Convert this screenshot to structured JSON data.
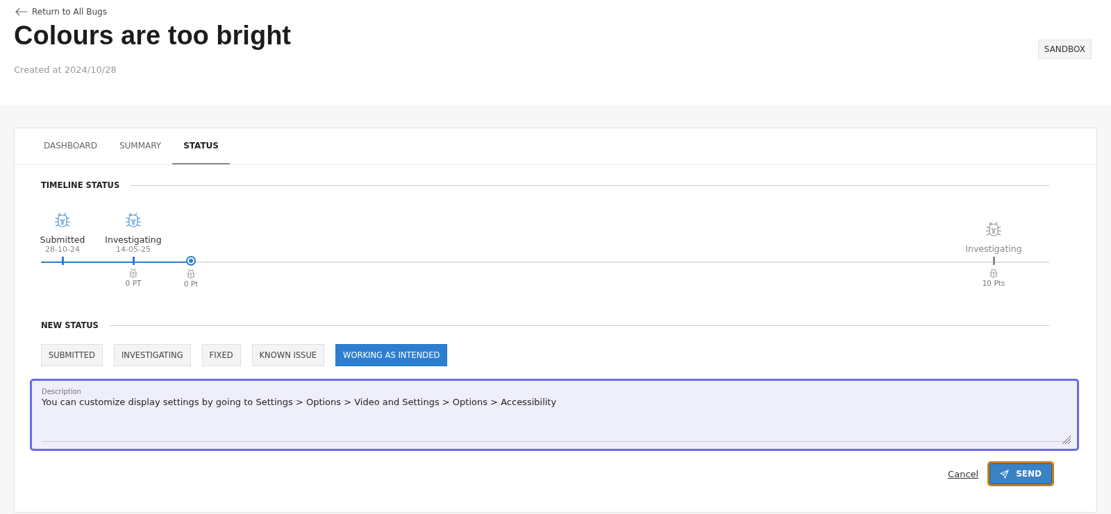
{
  "back_link": "Return to All Bugs",
  "title": "Colours are too bright",
  "created": "Created at 2024/10/28",
  "environment_badge": "SANDBOX",
  "tabs": [
    {
      "label": "DASHBOARD",
      "selected": false
    },
    {
      "label": "SUMMARY",
      "selected": false
    },
    {
      "label": "STATUS",
      "selected": true
    }
  ],
  "timeline": {
    "heading": "TIMELINE STATUS",
    "progress": {
      "level": 0.145
    },
    "points": [
      {
        "kind": "done",
        "label": "Submitted",
        "date": "28-10-24"
      },
      {
        "kind": "done",
        "label": "Investigating",
        "date": "14-05-25",
        "points": "0 PT"
      },
      {
        "kind": "current",
        "points": "0 Pt"
      },
      {
        "kind": "planned",
        "label": "Investigating",
        "points": "10 Pts"
      }
    ]
  },
  "new_status": {
    "heading": "NEW STATUS",
    "options": [
      {
        "label": "SUBMITTED",
        "selected": false
      },
      {
        "label": "INVESTIGATING",
        "selected": false
      },
      {
        "label": "FIXED",
        "selected": false
      },
      {
        "label": "KNOWN ISSUE",
        "selected": false
      },
      {
        "label": "WORKING AS INTENDED",
        "selected": true
      }
    ]
  },
  "description": {
    "label": "Description",
    "value": "You can customize display settings by going to Settings > Options > Video and Settings > Options > Accessibility"
  },
  "actions": {
    "cancel": "Cancel",
    "send": "SEND"
  }
}
